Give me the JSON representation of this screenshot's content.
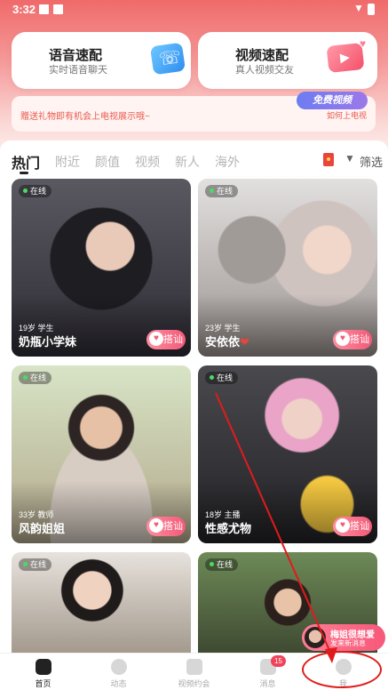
{
  "status_bar": {
    "time": "3:32"
  },
  "quick_match": [
    {
      "title": "语音速配",
      "subtitle": "实时语音聊天"
    },
    {
      "title": "视频速配",
      "subtitle": "真人视频交友"
    }
  ],
  "banner": {
    "text": "赠送礼物即有机会上电视展示哦~",
    "link": "如何上电视",
    "badge": "免费视频"
  },
  "tabs": [
    "热门",
    "附近",
    "颜值",
    "视频",
    "新人",
    "海外"
  ],
  "active_tab": 0,
  "filter_label": "筛选",
  "cards": [
    {
      "status": "在线",
      "meta": "19岁 学生",
      "name": "奶瓶小学妹",
      "chat": "搭讪"
    },
    {
      "status": "在线",
      "meta": "23岁 学生",
      "name": "安依依",
      "name_suffix": "❤",
      "chat": "搭讪"
    },
    {
      "status": "在线",
      "meta": "33岁 教师",
      "name": "风韵姐姐",
      "chat": "搭讪"
    },
    {
      "status": "在线",
      "meta": "18岁 主播",
      "name": "性感尤物",
      "chat": "搭讪"
    },
    {
      "status": "在线"
    },
    {
      "status": "在线"
    }
  ],
  "message_toast": {
    "title": "梅姐很想爱",
    "subtitle": "发来新消息"
  },
  "bottom_nav": [
    {
      "label": "首页",
      "icon": "home-icon"
    },
    {
      "label": "动态",
      "icon": "compass-icon"
    },
    {
      "label": "视频约会",
      "icon": "video-icon"
    },
    {
      "label": "消息",
      "icon": "message-icon",
      "badge": "15"
    },
    {
      "label": "我",
      "icon": "profile-icon"
    }
  ],
  "colors": {
    "accent": "#f25a78",
    "annotation": "#e01b1b"
  }
}
